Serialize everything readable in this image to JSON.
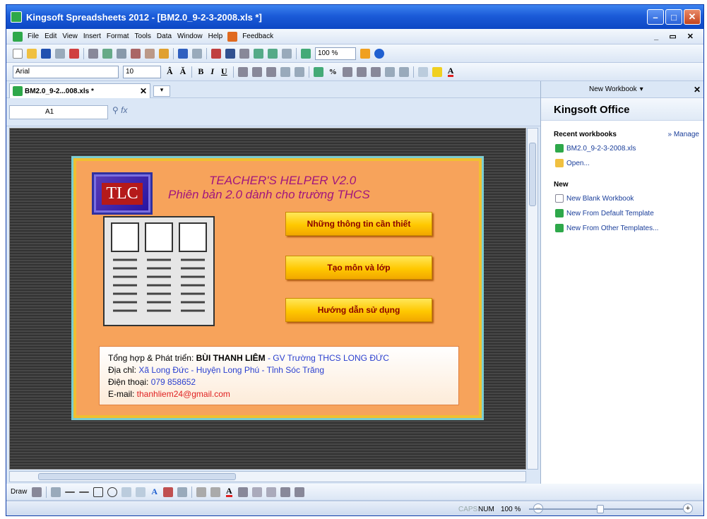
{
  "window": {
    "title": "Kingsoft Spreadsheets 2012 - [BM2.0_9-2-3-2008.xls *]"
  },
  "menu": [
    "File",
    "Edit",
    "View",
    "Insert",
    "Format",
    "Tools",
    "Data",
    "Window",
    "Help",
    "Feedback"
  ],
  "toolbar": {
    "zoom": "100 %",
    "font": "Arial",
    "font_size": "10"
  },
  "tab": {
    "label": "BM2.0_9-2...008.xls *"
  },
  "formula": {
    "cell_ref": "A1"
  },
  "panel": {
    "logo": "TLC",
    "title1": "TEACHER'S HELPER V2.0",
    "title2": "Phiên bản 2.0 dành cho trường THCS",
    "buttons": [
      "Những thông tin cần thiết",
      "Tạo môn và lớp",
      "Hướng dẫn sử dụng"
    ],
    "info": {
      "l1a": "Tổng hợp & Phát triển: ",
      "l1b": "BÙI THANH LIÊM",
      "l1c": " - GV Trường THCS LONG ĐỨC",
      "l2a": "Địa chỉ: ",
      "l2b": "Xã Long Đức - Huyện Long Phú - Tỉnh Sóc Trăng",
      "l3a": "Điện thoại: ",
      "l3b": "079 858652",
      "l4a": "E-mail: ",
      "l4b": "thanhliem24@gmail.com"
    }
  },
  "pane": {
    "header": "New Workbook",
    "title": "Kingsoft Office",
    "recent_label": "Recent workbooks",
    "manage": "» Manage",
    "recent": [
      "BM2.0_9-2-3-2008.xls",
      "Open..."
    ],
    "new_label": "New",
    "new_items": [
      "New Blank Workbook",
      "New From Default Template",
      "New From Other Templates..."
    ]
  },
  "drawbar": {
    "label": "Draw"
  },
  "status": {
    "caps": "CAPS",
    "num": "NUM",
    "zoom": "100 %"
  }
}
